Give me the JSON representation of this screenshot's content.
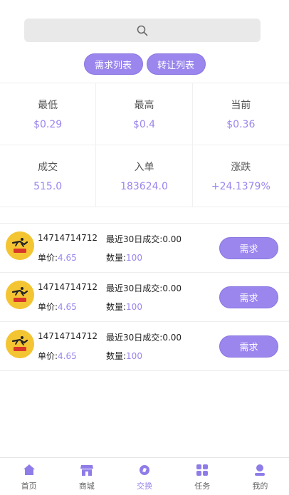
{
  "colors": {
    "accent": "#9b86ee"
  },
  "search": {
    "icon": "search-icon"
  },
  "tabs": [
    "需求列表",
    "转让列表"
  ],
  "stats": [
    {
      "label": "最低",
      "value": "$0.29"
    },
    {
      "label": "最高",
      "value": "$0.4"
    },
    {
      "label": "当前",
      "value": "$0.36"
    },
    {
      "label": "成交",
      "value": "515.0"
    },
    {
      "label": "入单",
      "value": "183624.0"
    },
    {
      "label": "涨跌",
      "value": "+24.1379%"
    }
  ],
  "listings": [
    {
      "id": "14714714712",
      "price_label": "单价:",
      "price": "4.65",
      "recent": "最近30日成交:0.00",
      "qty_label": "数量:",
      "qty": "100",
      "button": "需求"
    },
    {
      "id": "14714714712",
      "price_label": "单价:",
      "price": "4.65",
      "recent": "最近30日成交:0.00",
      "qty_label": "数量:",
      "qty": "100",
      "button": "需求"
    },
    {
      "id": "14714714712",
      "price_label": "单价:",
      "price": "4.65",
      "recent": "最近30日成交:0.00",
      "qty_label": "数量:",
      "qty": "100",
      "button": "需求"
    }
  ],
  "nav": [
    {
      "label": "首页",
      "icon": "home-icon",
      "active": false
    },
    {
      "label": "商城",
      "icon": "shop-icon",
      "active": false
    },
    {
      "label": "交换",
      "icon": "exchange-icon",
      "active": true
    },
    {
      "label": "任务",
      "icon": "task-grid-icon",
      "active": false
    },
    {
      "label": "我的",
      "icon": "user-icon",
      "active": false
    }
  ]
}
